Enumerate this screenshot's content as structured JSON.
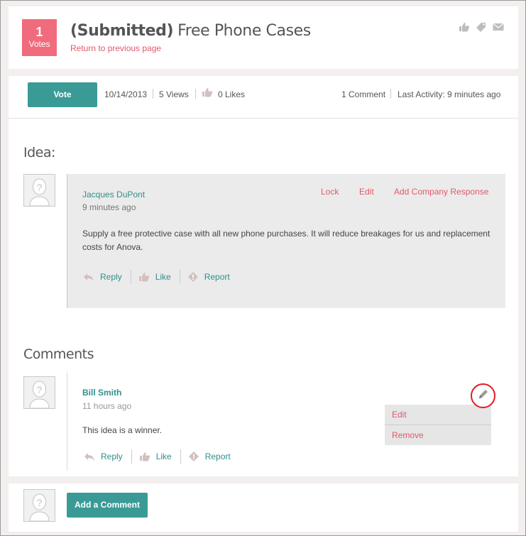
{
  "header": {
    "votes_count": "1",
    "votes_label": "Votes",
    "status": "(Submitted)",
    "title": "Free Phone Cases",
    "return_link": "Return to previous page",
    "icons": [
      "thumbs-up-icon",
      "tag-icon",
      "mail-icon"
    ]
  },
  "bar": {
    "vote_label": "Vote",
    "date": "10/14/2013",
    "views": "5 Views",
    "likes": "0 Likes",
    "comments": "1 Comment",
    "last_activity": "Last Activity: 9 minutes ago"
  },
  "idea": {
    "section_title": "Idea:",
    "author": "Jacques DuPont",
    "time": "9 minutes ago",
    "actions": {
      "lock": "Lock",
      "edit": "Edit",
      "company_response": "Add Company Response"
    },
    "body": "Supply a free protective case with all new phone purchases. It will reduce breakages for us and replacement costs for Anova.",
    "reply": "Reply",
    "like": "Like",
    "report": "Report"
  },
  "comments": {
    "section_title": "Comments",
    "items": [
      {
        "author": "Bill Smith",
        "time": "11 hours ago",
        "body": "This idea is a winner.",
        "reply": "Reply",
        "like": "Like",
        "report": "Report",
        "menu": {
          "edit": "Edit",
          "remove": "Remove"
        }
      }
    ]
  },
  "footer": {
    "add_comment": "Add a Comment"
  },
  "colors": {
    "accent": "#3a9b96",
    "link_red": "#e05a6b",
    "badge": "#f06b7c",
    "highlight_ring": "#e01b22"
  }
}
